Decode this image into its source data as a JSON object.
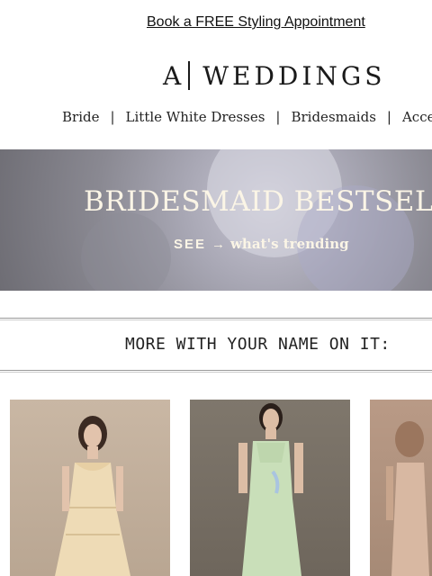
{
  "promo": {
    "link": "Book a FREE Styling Appointment"
  },
  "logo": {
    "left": "A",
    "right": "WEDDINGS"
  },
  "nav": {
    "items": [
      "Bride",
      "Little White Dresses",
      "Bridesmaids",
      "Acces"
    ],
    "separator": "|"
  },
  "hero": {
    "title": "BRIDESMAID BESTSELLER",
    "cta_see": "SEE",
    "cta_arrow": "→",
    "cta_text": "what's trending"
  },
  "section": {
    "title": "MORE WITH YOUR NAME ON IT:"
  },
  "colors": {
    "hero_text": "#fbf5e6",
    "text": "#222222"
  }
}
